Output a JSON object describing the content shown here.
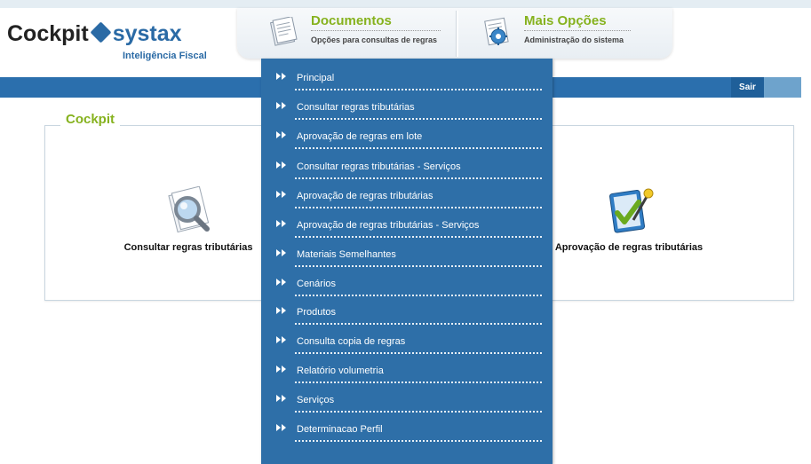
{
  "brand": {
    "part1": "Cockpit",
    "part2": "systax",
    "subtitle": "Inteligência Fiscal"
  },
  "tabs": [
    {
      "title": "Documentos",
      "subtitle": "Opções para consultas de regras",
      "icon": "documents-icon"
    },
    {
      "title": "Mais Opções",
      "subtitle": "Administração do sistema",
      "icon": "settings-icon"
    }
  ],
  "navbar": {
    "logout_label": "Sair"
  },
  "panel": {
    "title": "Cockpit",
    "tiles": [
      {
        "label": "Consultar regras tributárias",
        "icon": "magnifier-document-icon"
      },
      {
        "label": "Aprovação de regras tributárias",
        "icon": "approval-checkmark-icon"
      }
    ]
  },
  "menu": {
    "items": [
      "Principal",
      "Consultar regras tributárias",
      "Aprovação de regras em lote",
      "Consultar regras tributárias - Serviços",
      "Aprovação de regras tributárias",
      "Aprovação de regras tributárias - Serviços",
      "Materiais Semelhantes",
      "Cenários",
      "Produtos",
      "Consulta copia de regras",
      "Relatório volumetria",
      "Serviços",
      "Determinacao Perfil"
    ]
  },
  "colors": {
    "accent_green": "#86b21e",
    "nav_blue": "#2b6fad",
    "menu_blue": "#2e6fa8"
  }
}
